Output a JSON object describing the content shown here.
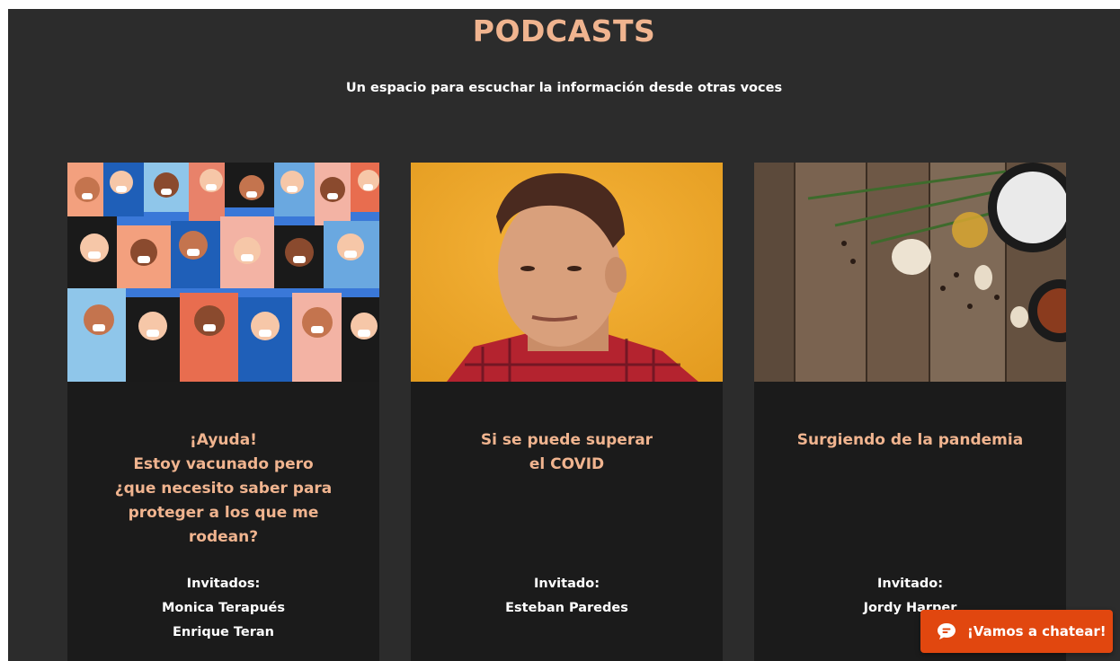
{
  "header": {
    "title": "PODCASTS",
    "subtitle": "Un espacio para escuchar la información desde otras voces"
  },
  "podcasts": [
    {
      "title": "¡Ayuda!\nEstoy vacunado pero\n¿que necesito saber para\nproteger a los que me\nrodean?",
      "guest_label": "Invitados:",
      "guests": [
        "Monica Terapués",
        "Enrique Teran"
      ]
    },
    {
      "title": "Si se puede superar\nel COVID",
      "guest_label": "Invitado:",
      "guests": [
        "Esteban Paredes"
      ]
    },
    {
      "title": "Surgiendo de la pandemia",
      "guest_label": "Invitado:",
      "guests": [
        "Jordy Harper"
      ]
    }
  ],
  "chat": {
    "label": "¡Vamos a chatear!",
    "icon": "chat-bubble-icon"
  },
  "colors": {
    "background": "#2c2c2c",
    "card": "#1b1b1b",
    "accent": "#f0b48f",
    "chat_button": "#e1470f"
  }
}
